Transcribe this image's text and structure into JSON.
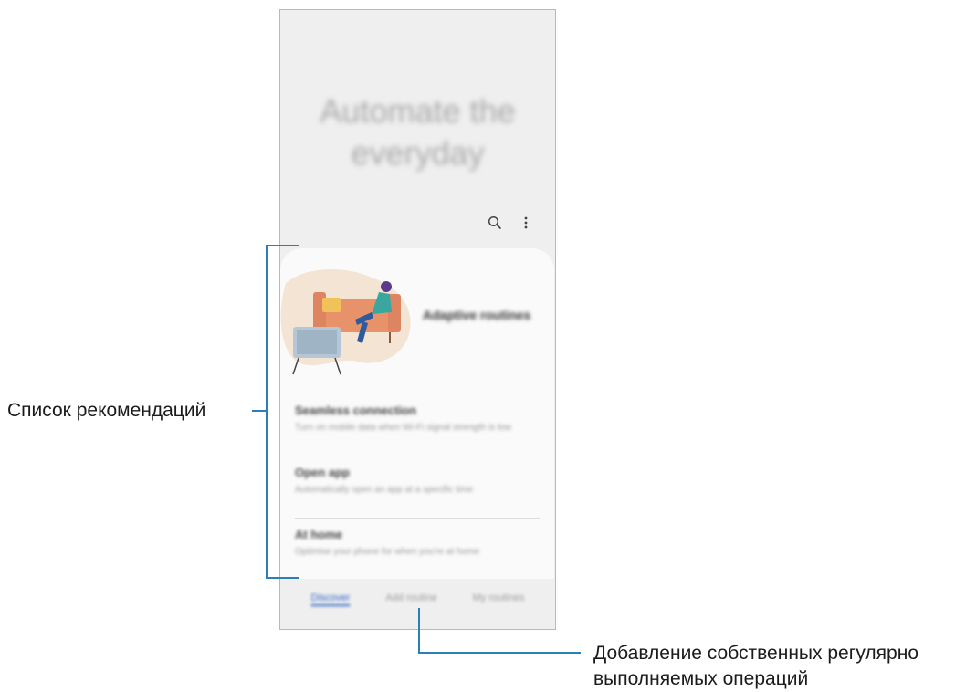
{
  "screen": {
    "hero_title_line1": "Automate the",
    "hero_title_line2": "everyday",
    "toolbar": {
      "search_icon": "search-icon",
      "more_icon": "more-vertical-icon"
    },
    "feature_card": {
      "title": "Adaptive routines",
      "illustration": "person-on-sofa-illustration"
    },
    "recommendations": [
      {
        "title": "Seamless connection",
        "description": "Turn on mobile data when Wi-Fi signal strength is low"
      },
      {
        "title": "Open app",
        "description": "Automatically open an app at a specific time"
      },
      {
        "title": "At home",
        "description": "Optimise your phone for when you're at home"
      }
    ],
    "partial_next_item": "",
    "tabs": [
      {
        "label": "Discover",
        "active": true
      },
      {
        "label": "Add routine",
        "active": false
      },
      {
        "label": "My routines",
        "active": false
      }
    ],
    "accent_color": "#2f63c8"
  },
  "callouts": {
    "recommendations_label": "Список рекомендаций",
    "add_routine_label_line1": "Добавление собственных регулярно",
    "add_routine_label_line2": "выполняемых операций",
    "line_color": "#2b7fb8"
  }
}
